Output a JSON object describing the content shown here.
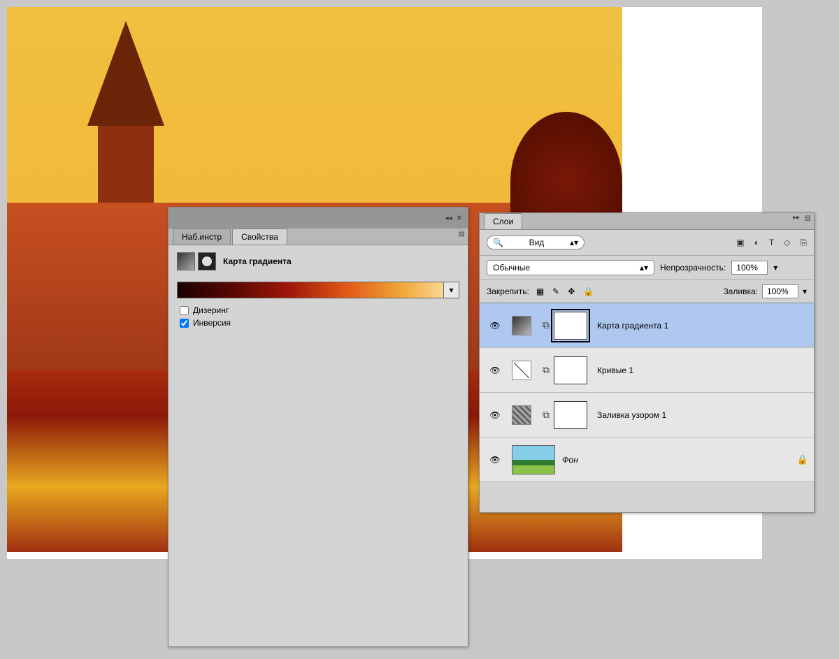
{
  "properties": {
    "tabs": {
      "instruments": "Наб.инстр",
      "properties": "Свойства"
    },
    "title": "Карта градиента",
    "dithering_label": "Дизеринг",
    "inversion_label": "Инверсия",
    "dithering_checked": false,
    "inversion_checked": true
  },
  "layers": {
    "tab": "Слои",
    "kind_label": "Вид",
    "blend_mode": "Обычные",
    "opacity_label": "Непрозрачность:",
    "opacity_value": "100%",
    "lock_label": "Закрепить:",
    "fill_label": "Заливка:",
    "fill_value": "100%",
    "items": [
      {
        "name": "Карта градиента 1"
      },
      {
        "name": "Кривые 1"
      },
      {
        "name": "Заливка узором 1"
      },
      {
        "name": "Фон"
      }
    ]
  },
  "icons": {
    "search": "🔍",
    "image": "▣",
    "adjust": "◐",
    "text": "T",
    "shape": "◇",
    "smart": "⎘",
    "checker": "▦",
    "brush": "✎",
    "move": "✥",
    "lock": "🔒",
    "eye": "👁",
    "link": "⧉",
    "collapse": "◂◂",
    "close": "✕",
    "menu": "▤",
    "expand": "▸▸",
    "chevron": "▾",
    "select_arrows": "▴▾"
  }
}
